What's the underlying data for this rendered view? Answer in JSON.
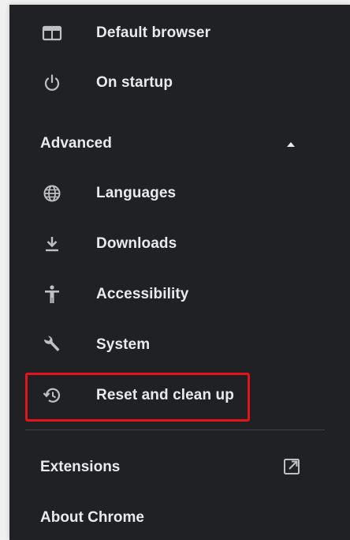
{
  "menu": {
    "items_top": [
      {
        "label": "Default browser",
        "icon": "browser-window-icon"
      },
      {
        "label": "On startup",
        "icon": "power-icon"
      }
    ],
    "advanced": {
      "label": "Advanced",
      "expanded": true,
      "items": [
        {
          "label": "Languages",
          "icon": "globe-icon"
        },
        {
          "label": "Downloads",
          "icon": "download-icon"
        },
        {
          "label": "Accessibility",
          "icon": "accessibility-icon"
        },
        {
          "label": "System",
          "icon": "wrench-icon"
        },
        {
          "label": "Reset and clean up",
          "icon": "restore-history-icon",
          "highlighted": true
        }
      ]
    },
    "extensions": {
      "label": "Extensions",
      "icon": "open-in-new-icon"
    },
    "about": {
      "label": "About Chrome"
    }
  },
  "colors": {
    "panel_background": "#202124",
    "text": "#e8eaed",
    "icon": "#bdc1c6",
    "highlight_border": "#e3141a"
  }
}
